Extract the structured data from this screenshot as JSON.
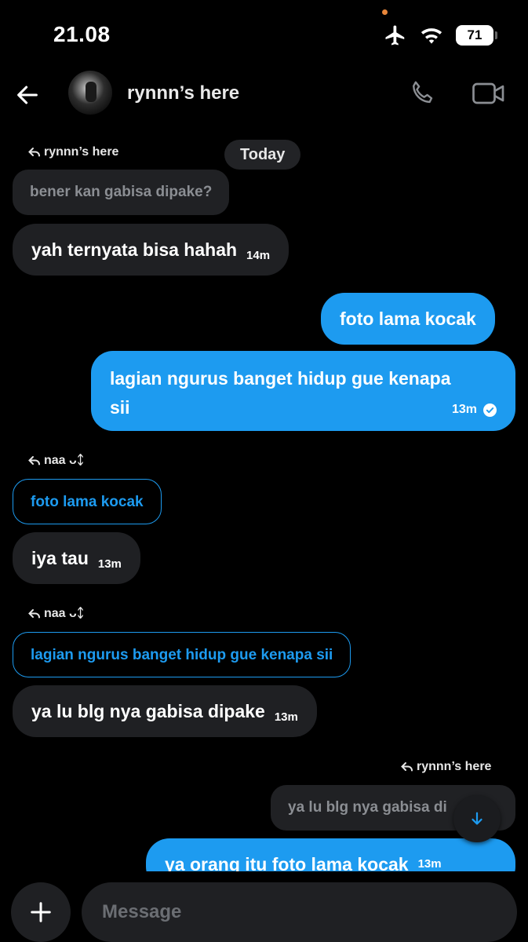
{
  "status_bar": {
    "time": "21.08",
    "battery": "71"
  },
  "header": {
    "title": "rynnn’s here"
  },
  "messages": {
    "date_divider": "Today",
    "m1": {
      "reply_to": "rynnn’s here",
      "quoted": "bener kan gabisa dipake?",
      "text": "yah ternyata bisa hahah",
      "time": "14m"
    },
    "m2": {
      "text": "foto lama kocak"
    },
    "m3": {
      "text_line1": "lagian ngurus banget hidup gue kenapa",
      "text_line2": "sii",
      "time": "13m"
    },
    "m4": {
      "reply_to": "naa ᴗᛨ",
      "quoted": "foto lama kocak",
      "text": "iya tau",
      "time": "13m"
    },
    "m5": {
      "reply_to": "naa ᴗᛨ",
      "quoted": "lagian ngurus banget hidup gue kenapa sii",
      "text": "ya lu blg nya gabisa dipake",
      "time": "13m"
    },
    "m6": {
      "reply_to": "rynnn’s here",
      "quoted": "ya lu blg nya gabisa di",
      "text": "ya orang itu foto lama kocak",
      "time": "13m"
    }
  },
  "composer": {
    "placeholder": "Message"
  },
  "colors": {
    "accent": "#1d9bf0",
    "incoming_bubble": "#1f2023",
    "background": "#000000"
  }
}
